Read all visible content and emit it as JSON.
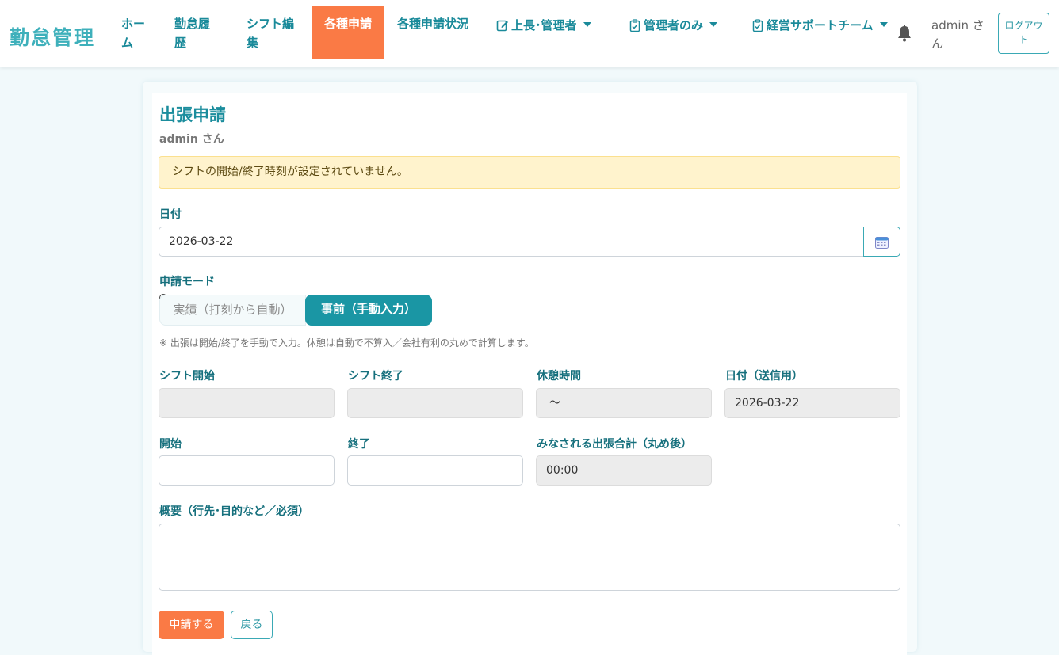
{
  "navbar": {
    "brand": "勤怠管理",
    "items": [
      {
        "label": "ホーム"
      },
      {
        "label": "勤怠履歴"
      },
      {
        "label": "シフト編集"
      },
      {
        "label": "各種申請"
      },
      {
        "label": "各種申請状況"
      }
    ],
    "dropdowns": [
      {
        "label": "上長･管理者",
        "icon": "edit-icon"
      },
      {
        "label": "管理者のみ",
        "icon": "clipboard-check-icon"
      },
      {
        "label": "経営サポートチーム",
        "icon": "clipboard-check-icon"
      }
    ],
    "bell_icon": "bell-icon",
    "user": "admin さん",
    "logout": "ログアウト"
  },
  "form": {
    "title": "出張申請",
    "subtitle": "admin さん",
    "alert": "シフトの開始/終了時刻が設定されていません。",
    "date_label": "日付",
    "date_value": "2026-03-22",
    "calendar_icon": "calendar-icon",
    "mode_label": "申請モード",
    "mode_actual": "実績（打刻から自動）",
    "mode_manual": "事前（手動入力）",
    "mode_selected": "事前（手動入力）",
    "note": "※ 出張は開始/終了を手動で入力。休憩は自動で不算入／会社有利の丸めで計算します。",
    "shift_start_label": "シフト開始",
    "shift_start_value": "",
    "shift_end_label": "シフト終了",
    "shift_end_value": "",
    "break_label": "休憩時間",
    "break_value": "〜",
    "send_date_label": "日付（送信用）",
    "send_date_value": "2026-03-22",
    "start_label": "開始",
    "start_value": "",
    "end_label": "終了",
    "end_value": "",
    "total_label": "みなされる出張合計（丸め後）",
    "total_value": "00:00",
    "summary_label": "概要（行先･目的など／必須）",
    "summary_value": "",
    "submit": "申請する",
    "back": "戻る"
  },
  "colors": {
    "accent": "#1a96a4",
    "brand": "#3eb0bb",
    "active_nav": "#fa7a45",
    "alert_bg": "#fff3cd"
  }
}
